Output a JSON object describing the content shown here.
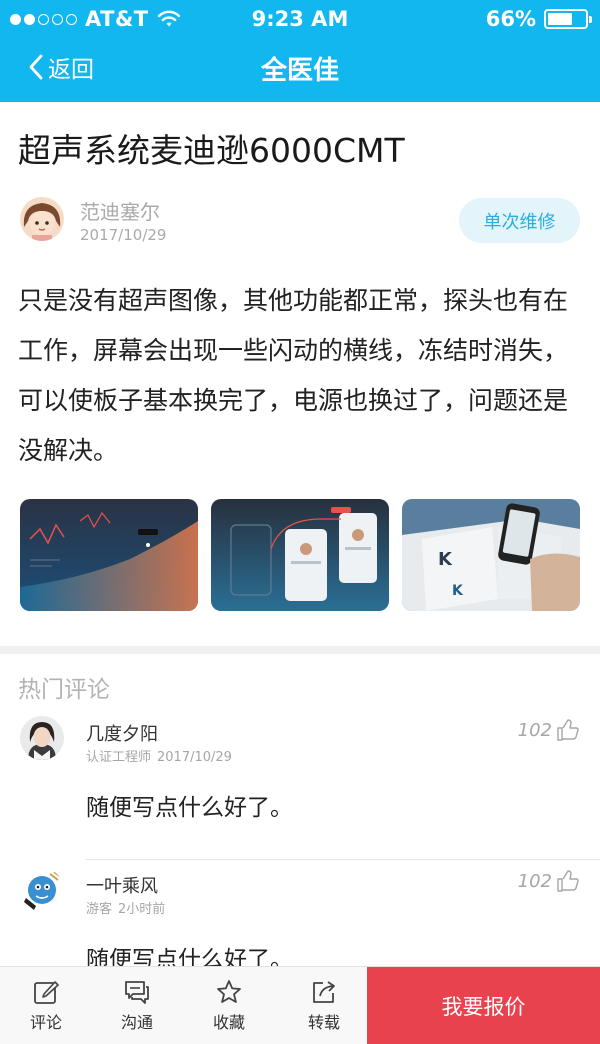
{
  "status_bar": {
    "carrier": "AT&T",
    "time": "9:23 AM",
    "battery_percent": "66%",
    "battery_level": 0.66,
    "signal_dots_filled": 2,
    "signal_dots_total": 5
  },
  "nav": {
    "back_label": "返回",
    "title": "全医佳"
  },
  "post": {
    "title": "超声系统麦迪逊6000CMT",
    "author_name": "范迪塞尔",
    "date": "2017/10/29",
    "tag": "单次维修",
    "body": "只是没有超声图像，其他功能都正常，探头也有在工作，屏幕会出现一些闪动的横线，冻结时消失，可以使板子基本换完了，电源也换过了，问题还是没解决。",
    "images": [
      "dashboard-chart-image",
      "app-flow-image",
      "brand-book-image"
    ]
  },
  "comments": {
    "section_title": "热门评论",
    "items": [
      {
        "name": "几度夕阳",
        "role": "认证工程师",
        "time": "2017/10/29",
        "likes": "102",
        "text": "随便写点什么好了。"
      },
      {
        "name": "一叶乘风",
        "role": "游客",
        "time": "2小时前",
        "likes": "102",
        "text": "随便写点什么好了。"
      }
    ]
  },
  "bottom_bar": {
    "items": [
      {
        "label": "评论",
        "icon": "edit-icon"
      },
      {
        "label": "沟通",
        "icon": "chat-icon"
      },
      {
        "label": "收藏",
        "icon": "star-icon"
      },
      {
        "label": "转载",
        "icon": "share-icon"
      }
    ],
    "quote_label": "我要报价"
  },
  "colors": {
    "header": "#13b7ef",
    "tag_bg": "#e3f4fb",
    "tag_text": "#2aaedf",
    "quote_button": "#e8424e"
  }
}
